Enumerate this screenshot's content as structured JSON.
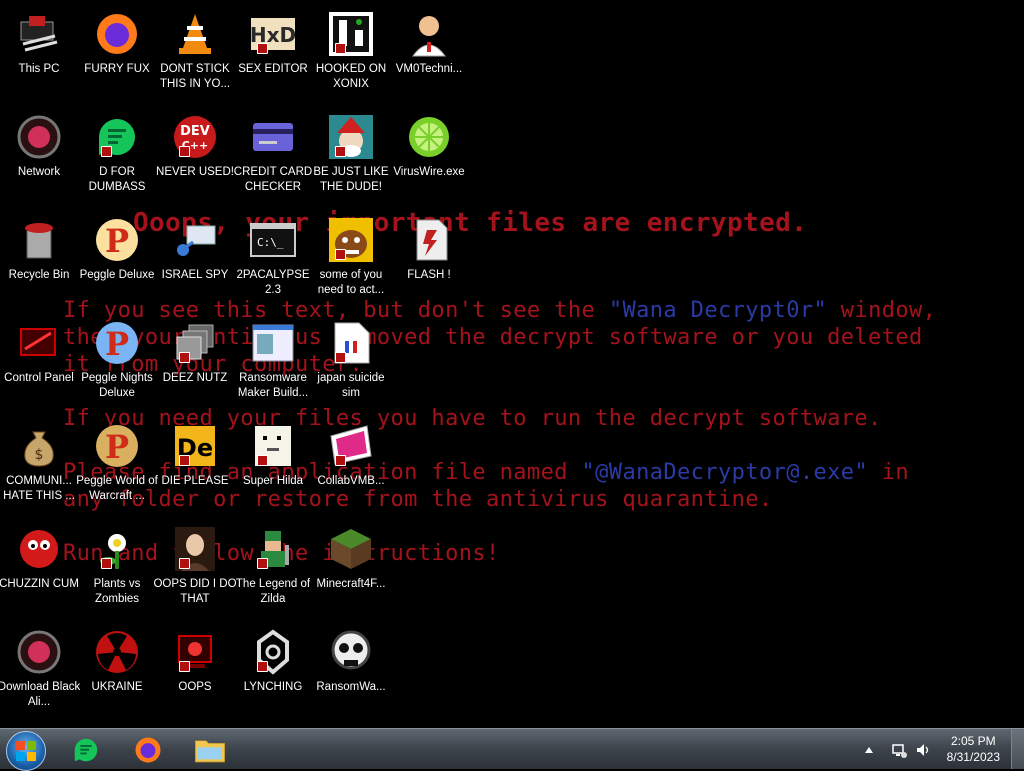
{
  "wallpaper": {
    "title": "Ooops, your important files are encrypted.",
    "p1_a": "If you see this text, but don't see the ",
    "p1_hl": "\"Wana Decrypt0r\"",
    "p1_b": " window,",
    "p1_line2": "then your antivirus removed the decrypt software or you deleted",
    "p1_line3": "it from your computer.",
    "p2": "If you need your files you have to run the decrypt software.",
    "p3_a": "Please find an application file named ",
    "p3_hl": "\"@WanaDecryptor@.exe\"",
    "p3_b": " in",
    "p3_line2": "any folder or restore from the antivirus quarantine.",
    "p4": "Run and follow the instructions!"
  },
  "icons": [
    {
      "label": "This PC"
    },
    {
      "label": "FURRY FUX"
    },
    {
      "label": "DONT STICK THIS IN YO..."
    },
    {
      "label": "SEX EDITOR"
    },
    {
      "label": "HOOKED ON XONIX"
    },
    {
      "label": "VM0Techni..."
    },
    {
      "label": "Network"
    },
    {
      "label": "D FOR DUMBASS"
    },
    {
      "label": "NEVER USED!"
    },
    {
      "label": "CREDIT CARD CHECKER"
    },
    {
      "label": "BE JUST LIKE THE DUDE!"
    },
    {
      "label": "VirusWire.exe"
    },
    {
      "label": "Recycle Bin"
    },
    {
      "label": "Peggle Deluxe"
    },
    {
      "label": "ISRAEL SPY"
    },
    {
      "label": "2PACALYPSE 2.3"
    },
    {
      "label": "some of you need to act..."
    },
    {
      "label": "FLASH !"
    },
    {
      "label": "Control Panel"
    },
    {
      "label": "Peggle Nights Deluxe"
    },
    {
      "label": "DEEZ NUTZ"
    },
    {
      "label": "Ransomware Maker Build..."
    },
    {
      "label": "japan suicide sim"
    },
    {
      "label": "COMMUNI... HATE THIS ..."
    },
    {
      "label": "Peggle World of Warcraft ..."
    },
    {
      "label": "DIE PLEASE"
    },
    {
      "label": "Super Hilda"
    },
    {
      "label": "CollabVMB..."
    },
    {
      "label": "CHUZZIN CUM"
    },
    {
      "label": "Plants vs Zombies"
    },
    {
      "label": "OOPS DID I DO THAT"
    },
    {
      "label": "The Legend of Zilda"
    },
    {
      "label": "Minecraft4F..."
    },
    {
      "label": "Download Black Ali..."
    },
    {
      "label": "UKRAINE"
    },
    {
      "label": "OOPS"
    },
    {
      "label": "LYNCHING"
    },
    {
      "label": "RansomWa..."
    }
  ],
  "taskbar": {
    "clock_time": "2:05 PM",
    "clock_date": "8/31/2023"
  }
}
